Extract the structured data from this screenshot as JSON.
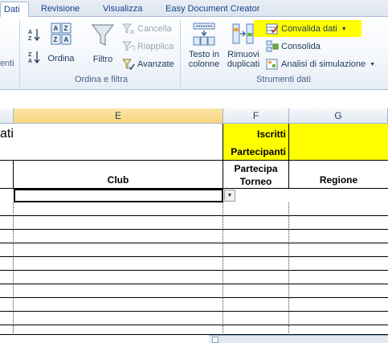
{
  "tabs": [
    {
      "label": "Dati",
      "active": true
    },
    {
      "label": "Revisione",
      "active": false
    },
    {
      "label": "Visualizza",
      "active": false
    },
    {
      "label": "Easy Document Creator",
      "active": false
    }
  ],
  "ribbon": {
    "left_group_tail": "enti",
    "sort": {
      "az_label": "",
      "sort_label": "Ordina",
      "filter_label": "Filtro"
    },
    "filter_group": {
      "clear": "Cancella",
      "reapply": "Riapplica",
      "advanced": "Avanzate",
      "label": "Ordina e filtra"
    },
    "tools_group": {
      "text_to_columns": "Testo in colonne",
      "text_to_columns_l1": "Testo in",
      "text_to_columns_l2": "colonne",
      "remove_dup_l1": "Rimuovi",
      "remove_dup_l2": "duplicati",
      "data_validation": "Convalida dati",
      "consolidate": "Consolida",
      "what_if": "Analisi di simulazione",
      "label": "Strumenti dati"
    }
  },
  "sheet": {
    "columns": [
      "E",
      "F",
      "G"
    ],
    "selected_column": "E",
    "title_fragment": "ati",
    "header_f1": "Iscritti",
    "header_f2": "Partecipanti",
    "col_e_header": "Club",
    "col_f_header_l1": "Partecipa",
    "col_f_header_l2": "Torneo",
    "col_g_header": "Regione",
    "highlight_color": "#ffff00"
  }
}
